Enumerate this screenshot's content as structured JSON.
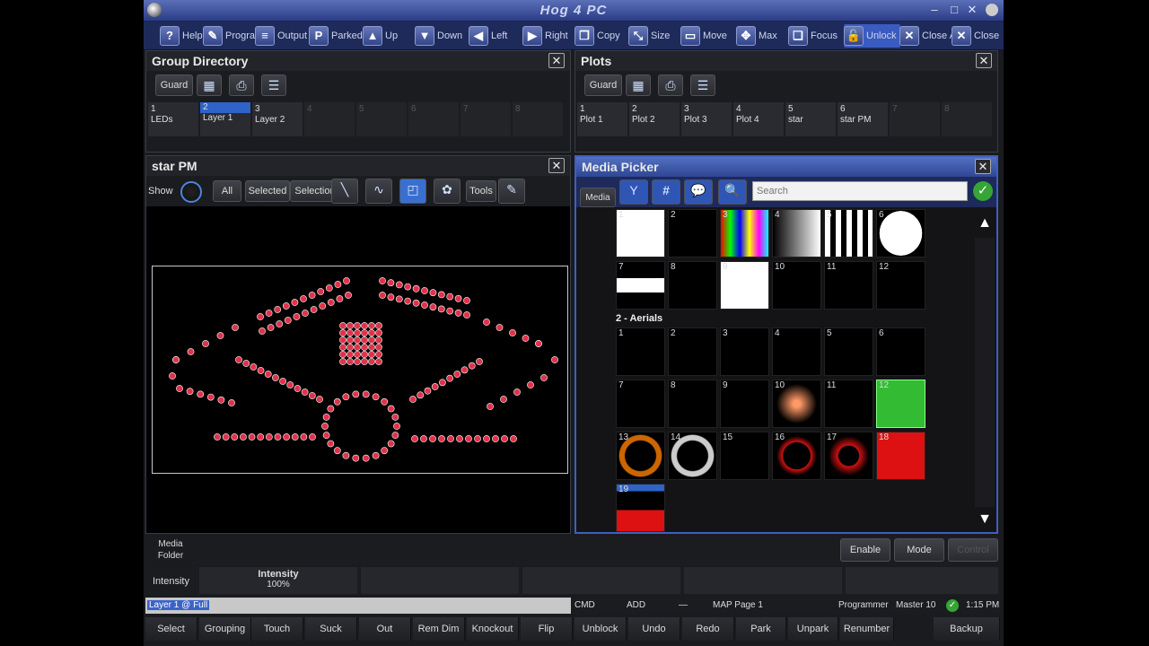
{
  "app": {
    "title": "Hog 4 PC"
  },
  "toolbar": [
    {
      "label": "Help",
      "icon": "help-icon",
      "glyph": "?"
    },
    {
      "label": "Program",
      "icon": "pencil-icon",
      "glyph": "✎"
    },
    {
      "label": "Output",
      "icon": "output-icon",
      "glyph": "≡"
    },
    {
      "label": "Parked",
      "icon": "parked-icon",
      "glyph": "P"
    },
    {
      "label": "Up",
      "icon": "arrow-up-icon",
      "glyph": "▲"
    },
    {
      "label": "Down",
      "icon": "arrow-down-icon",
      "glyph": "▼"
    },
    {
      "label": "Left",
      "icon": "arrow-left-icon",
      "glyph": "◀"
    },
    {
      "label": "Right",
      "icon": "arrow-right-icon",
      "glyph": "▶"
    },
    {
      "label": "Copy",
      "icon": "copy-icon",
      "glyph": "❐"
    },
    {
      "label": "Size",
      "icon": "size-icon",
      "glyph": "⤡"
    },
    {
      "label": "Move",
      "icon": "move-icon",
      "glyph": "▭"
    },
    {
      "label": "Max",
      "icon": "max-icon",
      "glyph": "✥"
    },
    {
      "label": "Focus",
      "icon": "focus-icon",
      "glyph": "❏"
    },
    {
      "label": "Unlock",
      "icon": "unlock-icon",
      "glyph": "🔓"
    },
    {
      "label": "Close A",
      "icon": "close-all-icon",
      "glyph": "✕"
    },
    {
      "label": "Close",
      "icon": "close-icon",
      "glyph": "✕"
    }
  ],
  "group_directory": {
    "title": "Group Directory",
    "guard": "Guard",
    "cells": [
      {
        "num": "1",
        "label": "LEDs"
      },
      {
        "num": "2",
        "label": "Layer 1",
        "selected": true
      },
      {
        "num": "3",
        "label": "Layer 2"
      },
      {
        "num": "4",
        "label": ""
      },
      {
        "num": "5",
        "label": ""
      },
      {
        "num": "6",
        "label": ""
      },
      {
        "num": "7",
        "label": ""
      },
      {
        "num": "8",
        "label": ""
      }
    ]
  },
  "plots": {
    "title": "Plots",
    "guard": "Guard",
    "cells": [
      {
        "num": "1",
        "label": "Plot 1"
      },
      {
        "num": "2",
        "label": "Plot 2"
      },
      {
        "num": "3",
        "label": "Plot 3"
      },
      {
        "num": "4",
        "label": "Plot 4"
      },
      {
        "num": "5",
        "label": "star"
      },
      {
        "num": "6",
        "label": "star PM"
      },
      {
        "num": "7",
        "label": ""
      },
      {
        "num": "8",
        "label": ""
      }
    ]
  },
  "plot_view": {
    "title": "star PM",
    "show": "Show",
    "all": "All",
    "selected": "Selected",
    "selection": "Selection",
    "tools": "Tools",
    "fixture_color": "#e0334a"
  },
  "media_picker": {
    "title": "Media Picker",
    "media_tab": "Media",
    "search_placeholder": "Search",
    "section_label": "2 - Aerials",
    "group1": [
      "1",
      "2",
      "3",
      "4",
      "5",
      "6",
      "7",
      "8",
      "9",
      "10",
      "11",
      "12"
    ],
    "group2": [
      "1",
      "2",
      "3",
      "4",
      "5",
      "6",
      "7",
      "8",
      "9",
      "10",
      "11",
      "12",
      "13",
      "14",
      "15",
      "16",
      "17",
      "18",
      "19"
    ]
  },
  "media_bar": {
    "media_folder": "Media\nFolder",
    "enable": "Enable",
    "mode": "Mode",
    "control": "Control"
  },
  "intensity_bar": {
    "label": "Intensity",
    "name": "Intensity",
    "value": "100%"
  },
  "status": {
    "layer": "Layer 1 @ Full",
    "cmd": "CMD",
    "add": "ADD",
    "dash": "—",
    "map": "MAP Page 1",
    "programmer": "Programmer",
    "master": "Master 10",
    "time": "1:15 PM"
  },
  "bottom_buttons": [
    "Select",
    "Grouping",
    "Touch",
    "Suck",
    "Out",
    "Rem Dim",
    "Knockout",
    "Flip",
    "Unblock",
    "Undo",
    "Redo",
    "Park",
    "Unpark",
    "Renumber",
    "Backup"
  ]
}
